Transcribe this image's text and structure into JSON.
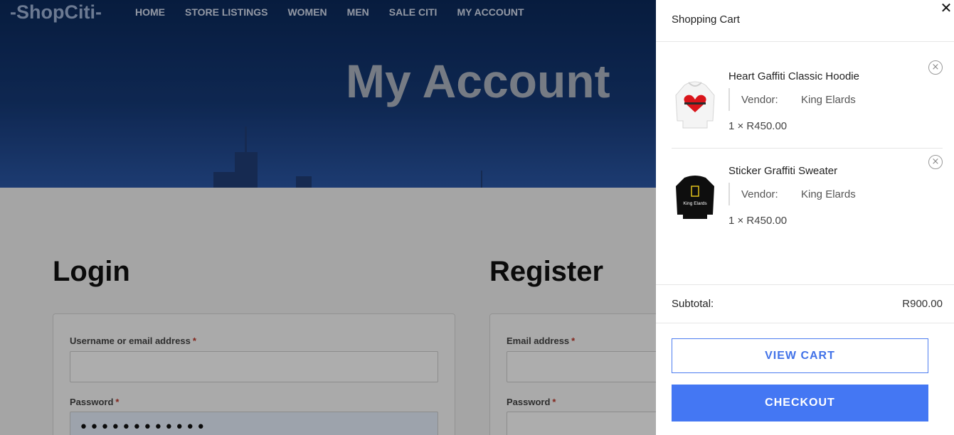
{
  "site": {
    "logo_text": "-ShopCiti-",
    "nav": [
      "HOME",
      "STORE LISTINGS",
      "WOMEN",
      "MEN",
      "SALE CITI",
      "MY ACCOUNT"
    ]
  },
  "hero": {
    "title": "My Account"
  },
  "login": {
    "title": "Login",
    "username_label": "Username or email address",
    "required_mark": "*",
    "password_label": "Password",
    "password_value": "••••••••••••"
  },
  "register": {
    "title": "Register",
    "email_label": "Email address",
    "required_mark": "*",
    "password_label": "Password"
  },
  "cart": {
    "title": "Shopping Cart",
    "close_glyph": "✕",
    "remove_glyph": "×",
    "items": [
      {
        "name": "Heart Gaffiti Classic Hoodie",
        "vendor_label": "Vendor:",
        "vendor": "King Elards",
        "qty_price": "1 × R450.00",
        "thumb_icon": "white-hoodie-heart-icon"
      },
      {
        "name": "Sticker Graffiti Sweater",
        "vendor_label": "Vendor:",
        "vendor": "King Elards",
        "qty_price": "1 × R450.00",
        "thumb_icon": "black-sweater-icon",
        "thumb_text": "King Elards"
      }
    ],
    "subtotal_label": "Subtotal:",
    "subtotal_value": "R900.00",
    "view_cart_label": "VIEW CART",
    "checkout_label": "CHECKOUT"
  },
  "colors": {
    "accent": "#4477f3",
    "hero_dark": "#0b2a5c",
    "required": "#c0392b"
  }
}
